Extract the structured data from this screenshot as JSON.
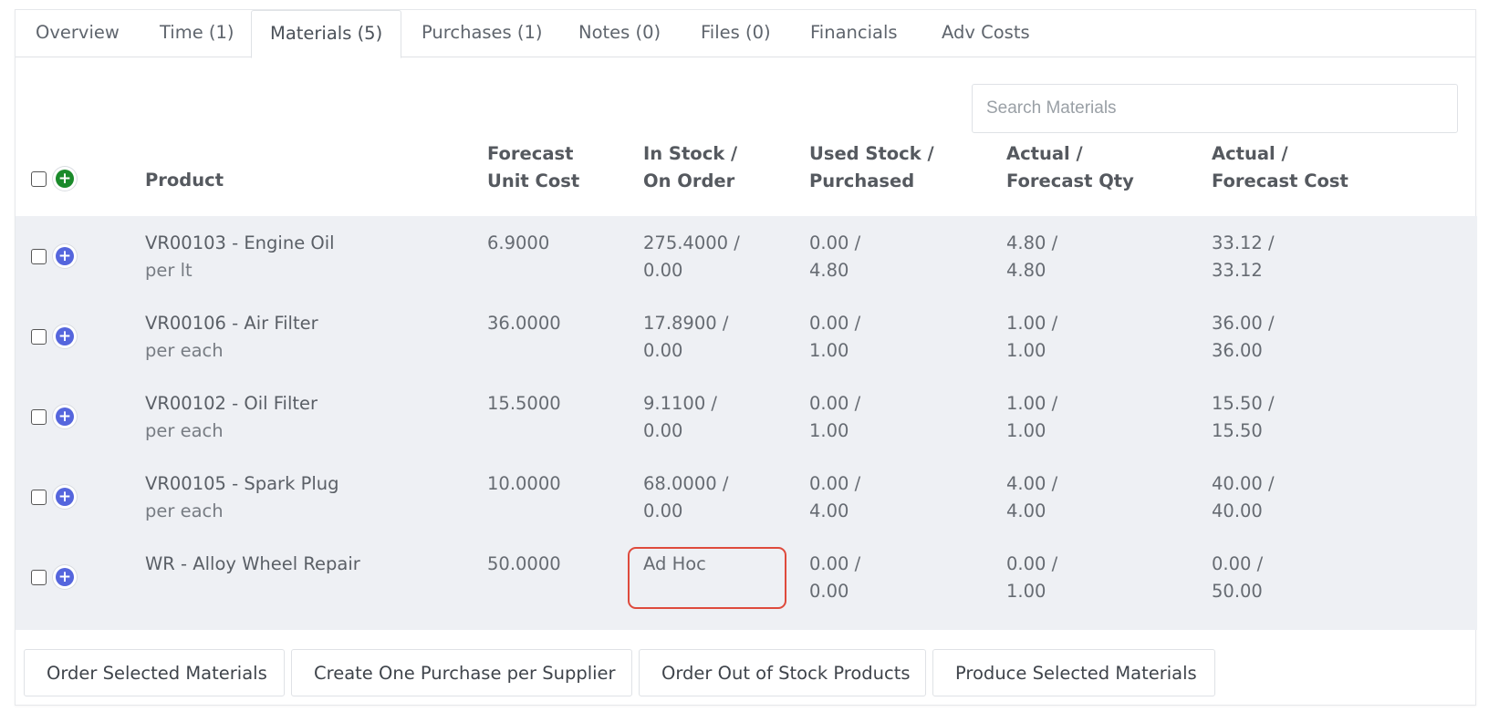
{
  "tabs": [
    {
      "label": "Overview"
    },
    {
      "label": "Time (1)"
    },
    {
      "label": "Materials (5)",
      "active": true
    },
    {
      "label": "Purchases (1)"
    },
    {
      "label": "Notes (0)"
    },
    {
      "label": "Files (0)"
    },
    {
      "label": "Financials"
    },
    {
      "label": "Adv Costs"
    }
  ],
  "search": {
    "placeholder": "Search Materials",
    "value": ""
  },
  "columns": {
    "product": "Product",
    "forecast_unit_cost": [
      "Forecast",
      "Unit Cost"
    ],
    "in_stock": [
      "In Stock /",
      "On Order"
    ],
    "used_stock": [
      "Used Stock /",
      "Purchased"
    ],
    "actual_qty": [
      "Actual /",
      "Forecast Qty"
    ],
    "actual_cost": [
      "Actual /",
      "Forecast Cost"
    ]
  },
  "rows": [
    {
      "product": "VR00103 - Engine Oil",
      "unit": "per lt",
      "forecast_unit_cost": "6.9000",
      "in_stock": [
        "275.4000 /",
        "0.00"
      ],
      "used_stock": [
        "0.00 /",
        "4.80"
      ],
      "actual_qty": [
        "4.80 /",
        "4.80"
      ],
      "actual_cost": [
        "33.12 /",
        "33.12"
      ]
    },
    {
      "product": "VR00106 - Air Filter",
      "unit": "per each",
      "forecast_unit_cost": "36.0000",
      "in_stock": [
        "17.8900 /",
        "0.00"
      ],
      "used_stock": [
        "0.00 /",
        "1.00"
      ],
      "actual_qty": [
        "1.00 /",
        "1.00"
      ],
      "actual_cost": [
        "36.00 /",
        "36.00"
      ]
    },
    {
      "product": "VR00102 - Oil Filter",
      "unit": "per each",
      "forecast_unit_cost": "15.5000",
      "in_stock": [
        "9.1100 /",
        "0.00"
      ],
      "used_stock": [
        "0.00 /",
        "1.00"
      ],
      "actual_qty": [
        "1.00 /",
        "1.00"
      ],
      "actual_cost": [
        "15.50 /",
        "15.50"
      ]
    },
    {
      "product": "VR00105 - Spark Plug",
      "unit": "per each",
      "forecast_unit_cost": "10.0000",
      "in_stock": [
        "68.0000 /",
        "0.00"
      ],
      "used_stock": [
        "0.00 /",
        "4.00"
      ],
      "actual_qty": [
        "4.00 /",
        "4.00"
      ],
      "actual_cost": [
        "40.00 /",
        "40.00"
      ]
    },
    {
      "product": "WR - Alloy Wheel Repair",
      "unit": "",
      "forecast_unit_cost": "50.0000",
      "in_stock": [
        "Ad Hoc",
        ""
      ],
      "used_stock": [
        "0.00 /",
        "0.00"
      ],
      "actual_qty": [
        "0.00 /",
        "1.00"
      ],
      "actual_cost": [
        "0.00 /",
        "50.00"
      ]
    }
  ],
  "buttons": {
    "order_selected": "Order Selected Materials",
    "create_purchase": "Create One Purchase per Supplier",
    "order_out_of_stock": "Order Out of Stock Products",
    "produce_selected": "Produce Selected Materials"
  },
  "icons": {
    "add": "plus-circle-icon"
  },
  "colors": {
    "add_header": "#1a8a2a",
    "add_row": "#5566dd",
    "highlight": "#de4a3c",
    "row_bg": "#eef0f4"
  }
}
